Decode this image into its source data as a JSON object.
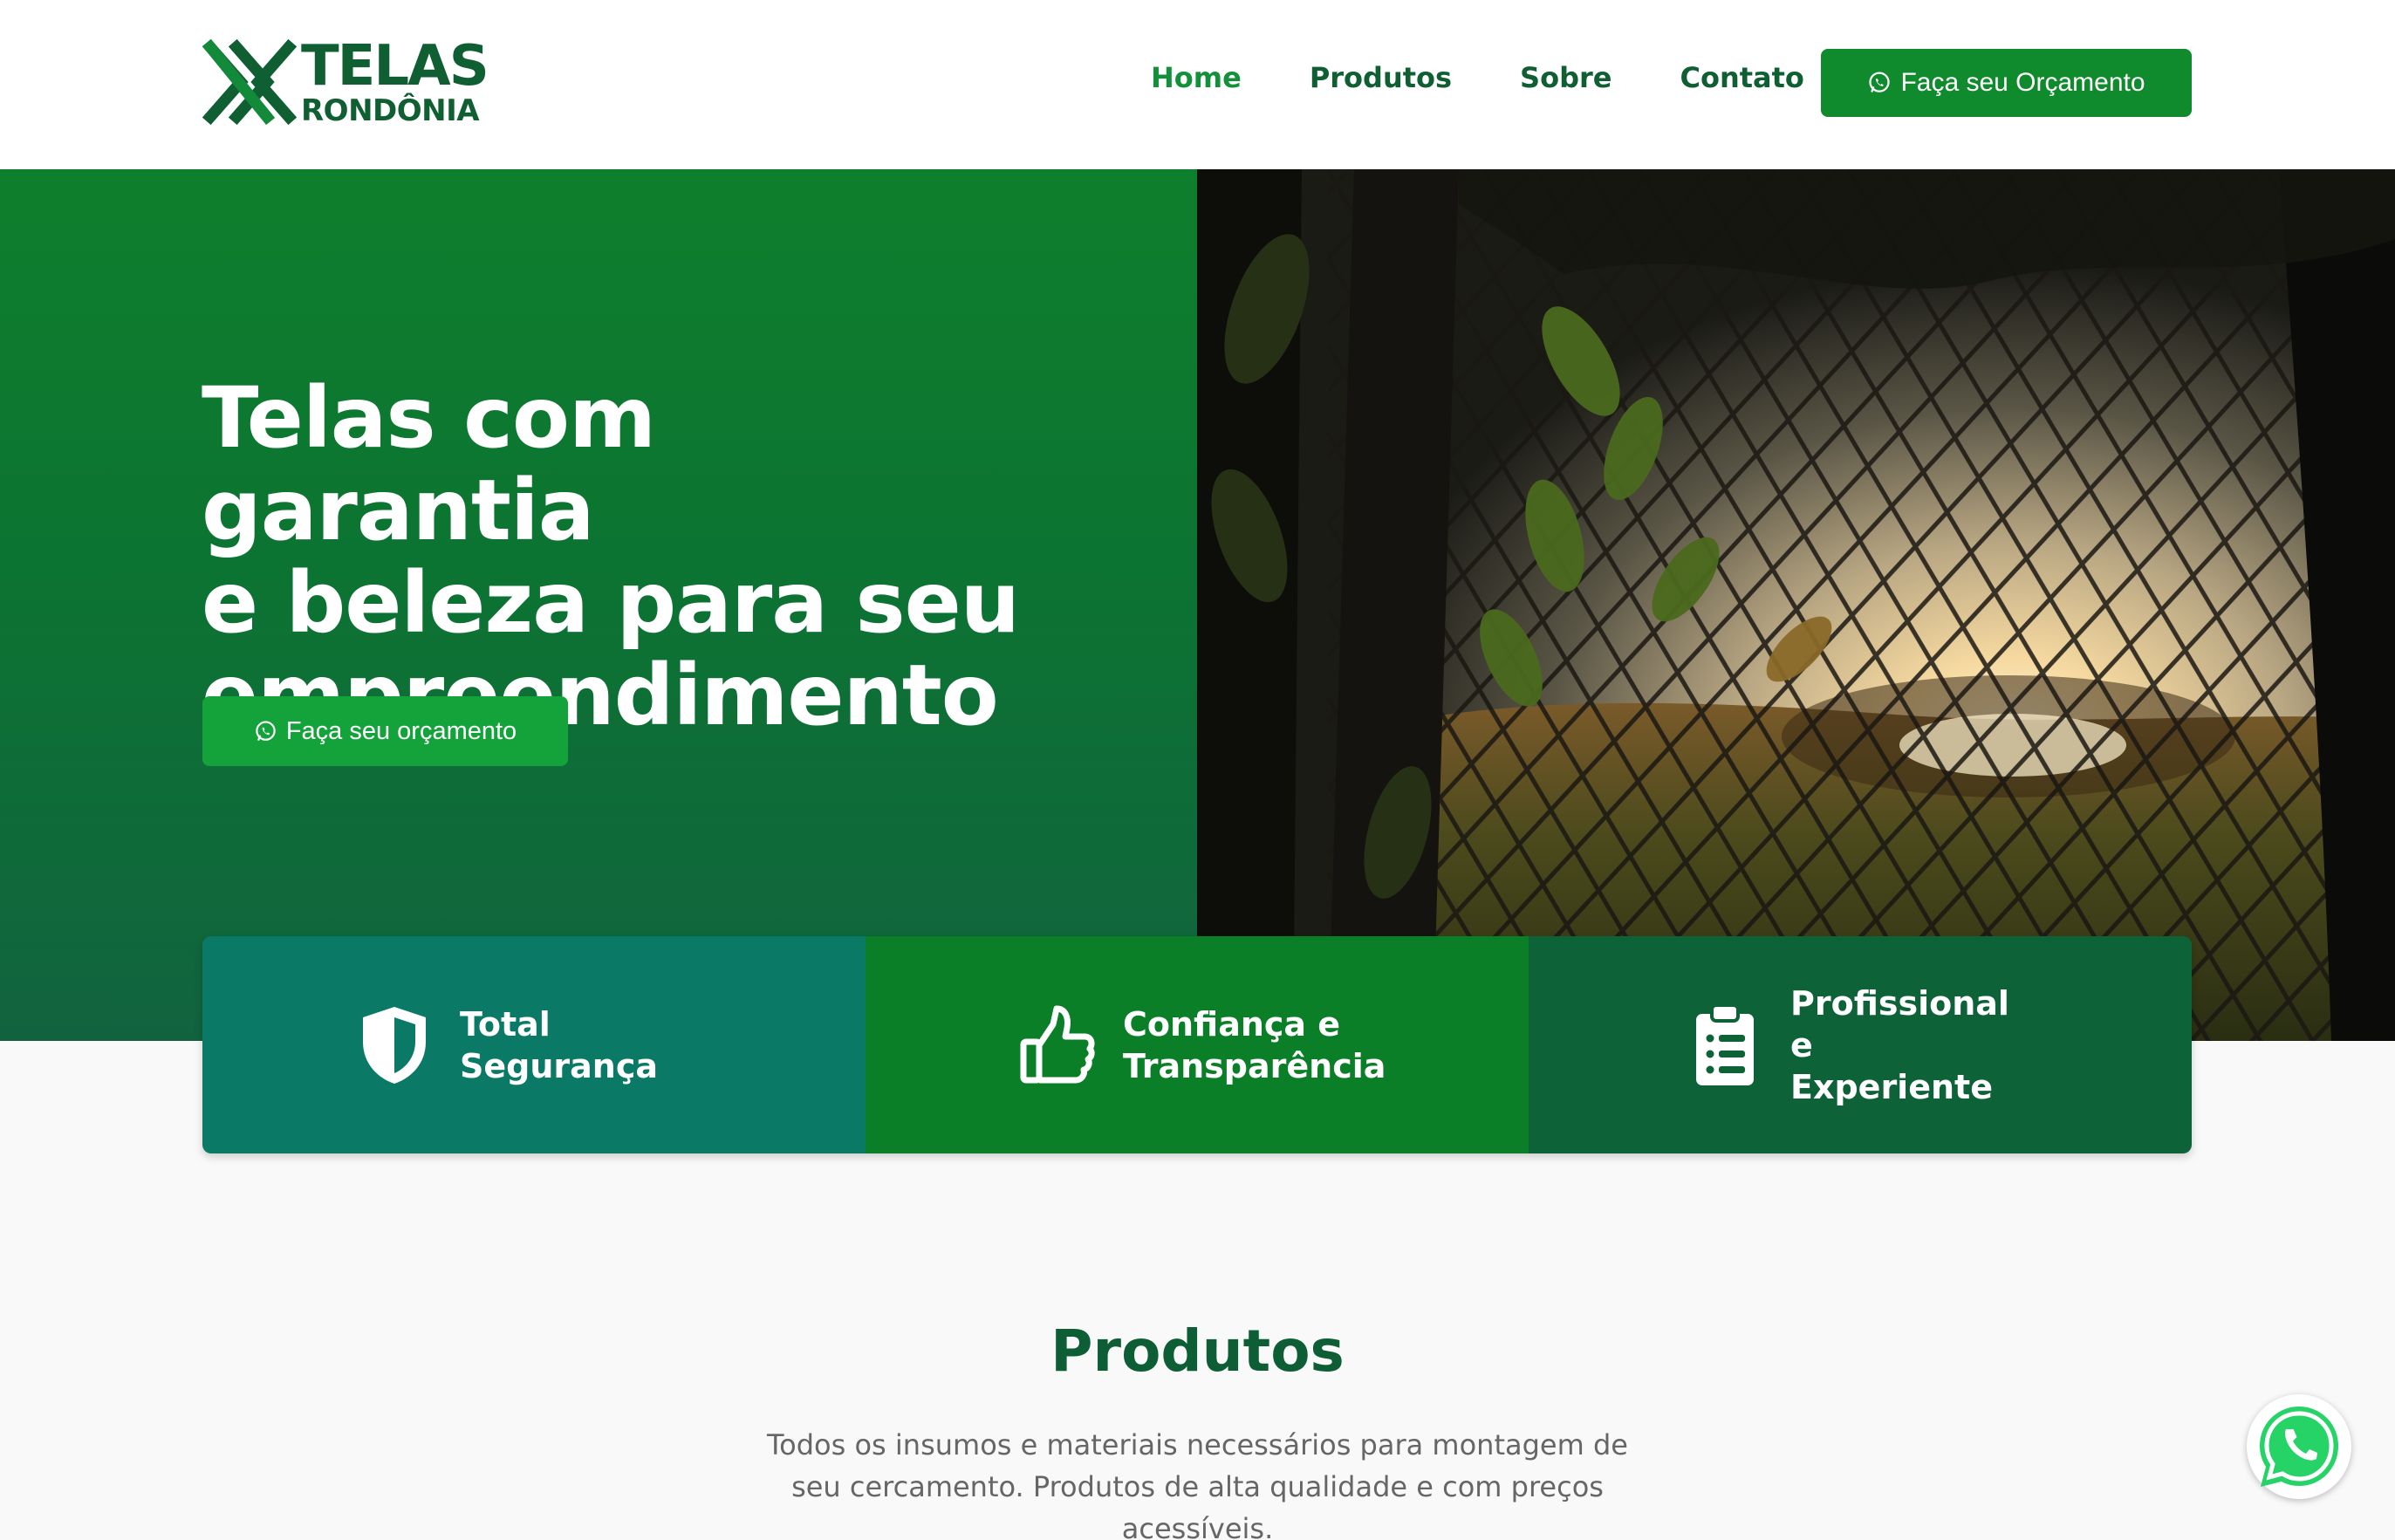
{
  "brand": {
    "title": "TELAS",
    "subtitle": "RONDÔNIA"
  },
  "nav": {
    "items": [
      {
        "label": "Home",
        "active": true
      },
      {
        "label": "Produtos",
        "active": false
      },
      {
        "label": "Sobre",
        "active": false
      },
      {
        "label": "Contato",
        "active": false
      }
    ],
    "cta_label": "Faça seu Orçamento"
  },
  "hero": {
    "title_lines": [
      "Telas com garantia",
      "e beleza para seu",
      "empreendimento"
    ],
    "cta_label": "Faça seu orçamento"
  },
  "features": [
    {
      "icon": "shield-icon",
      "line1": "Total",
      "line2": "Segurança"
    },
    {
      "icon": "thumbs-up-icon",
      "line1": "Confiança e",
      "line2": "Transparência"
    },
    {
      "icon": "clipboard-list-icon",
      "line1": "Profissional e",
      "line2": "Experiente"
    }
  ],
  "products": {
    "title": "Produtos",
    "description": "Todos os insumos e materiais necessários para montagem de seu cercamento. Produtos de alta qualidade e com preços acessíveis."
  },
  "colors": {
    "brand_dark": "#0f5f32",
    "brand_green": "#0f8a2c",
    "hero_gradient_top": "#0e7f2c",
    "hero_gradient_bottom": "#11633f",
    "card_teal": "#0a7a66",
    "card_green": "#0b7f27",
    "card_dark": "#0d6238",
    "whatsapp": "#25d366"
  }
}
